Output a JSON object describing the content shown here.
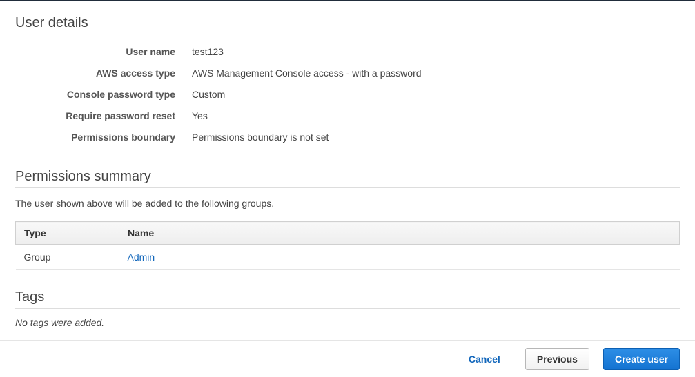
{
  "userDetails": {
    "title": "User details",
    "rows": {
      "userName": {
        "label": "User name",
        "value": "test123"
      },
      "accessType": {
        "label": "AWS access type",
        "value": "AWS Management Console access - with a password"
      },
      "pwdType": {
        "label": "Console password type",
        "value": "Custom"
      },
      "reqReset": {
        "label": "Require password reset",
        "value": "Yes"
      },
      "permBound": {
        "label": "Permissions boundary",
        "value": "Permissions boundary is not set"
      }
    }
  },
  "permissions": {
    "title": "Permissions summary",
    "description": "The user shown above will be added to the following groups.",
    "columns": {
      "type": "Type",
      "name": "Name"
    },
    "rows": [
      {
        "type": "Group",
        "name": "Admin"
      }
    ]
  },
  "tags": {
    "title": "Tags",
    "empty": "No tags were added."
  },
  "footer": {
    "cancel": "Cancel",
    "previous": "Previous",
    "create": "Create user"
  }
}
